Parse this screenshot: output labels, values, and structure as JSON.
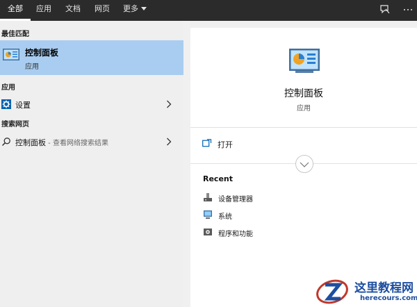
{
  "topbar": {
    "tabs": [
      {
        "label": "全部",
        "active": true
      },
      {
        "label": "应用"
      },
      {
        "label": "文档"
      },
      {
        "label": "网页"
      },
      {
        "label": "更多"
      }
    ],
    "feedback_icon": "feedback-icon",
    "more_icon": "ellipsis-icon"
  },
  "left": {
    "best_match_header": "最佳匹配",
    "best_match": {
      "title": "控制面板",
      "subtitle": "应用",
      "icon": "control-panel-icon"
    },
    "apps_header": "应用",
    "apps": [
      {
        "label": "设置",
        "icon": "gear-icon"
      }
    ],
    "web_header": "搜索网页",
    "web": [
      {
        "label": "控制面板",
        "suffix": " - 查看网络搜索结果",
        "icon": "search-icon"
      }
    ]
  },
  "right": {
    "title": "控制面板",
    "subtitle": "应用",
    "open_label": "打开",
    "recent_title": "Recent",
    "recent": [
      {
        "label": "设备管理器",
        "icon": "device-manager-icon"
      },
      {
        "label": "系统",
        "icon": "system-icon"
      },
      {
        "label": "程序和功能",
        "icon": "programs-icon"
      }
    ]
  },
  "watermark": {
    "text": "这里教程网",
    "url": "herecours.com"
  },
  "colors": {
    "topbar": "#2b2b2b",
    "selected": "#a9cdf0",
    "accent": "#0063b1"
  }
}
